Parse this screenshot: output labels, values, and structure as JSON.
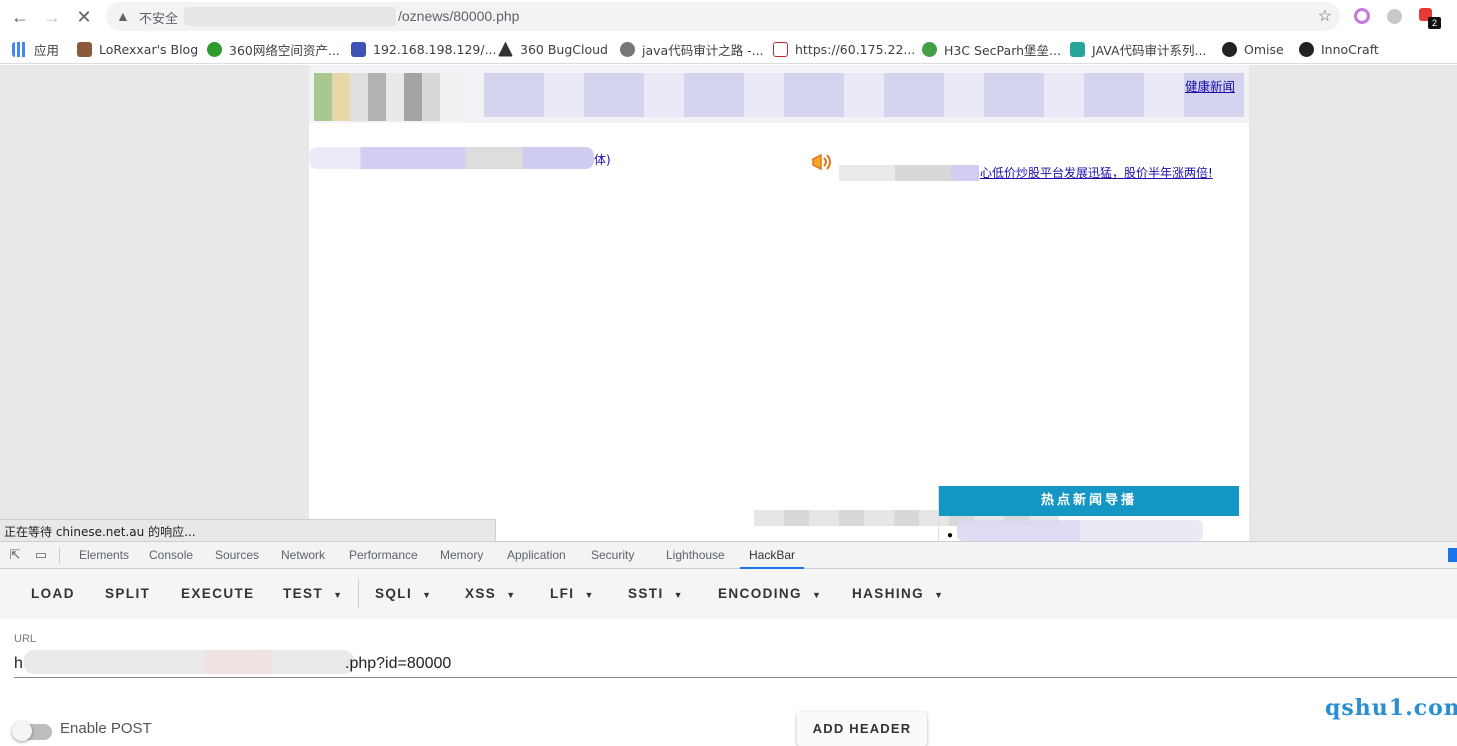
{
  "browser": {
    "insecure_label": "不安全",
    "url_tail": "/oznews/80000.php",
    "badge_count": "2"
  },
  "bookmarks": [
    {
      "label": "应用",
      "color": "#4285f4"
    },
    {
      "label": "LoRexxar's Blog",
      "color": "#8b5a3c"
    },
    {
      "label": "360网络空间资产...",
      "color": "#2e9b2e"
    },
    {
      "label": "192.168.198.129/...",
      "color": "#3f51b5"
    },
    {
      "label": "360 BugCloud",
      "color": "#333333"
    },
    {
      "label": "java代码审计之路 -...",
      "color": "#555555"
    },
    {
      "label": "https://60.175.22...",
      "color": "#c62828"
    },
    {
      "label": "H3C SecParh堡垒...",
      "color": "#43a047"
    },
    {
      "label": "JAVA代码审计系列...",
      "color": "#26a69a"
    },
    {
      "label": "Omise",
      "color": "#222222"
    },
    {
      "label": "InnoCraft",
      "color": "#222222"
    }
  ],
  "page": {
    "nav_last": "健康新闻",
    "site_title_tail": "体)",
    "ticker": "心低价炒股平台发展迅猛，股价半年涨两倍!",
    "hot_news_title": "热点新闻导播",
    "status_text": "正在等待 chinese.net.au 的响应..."
  },
  "devtools": {
    "tabs": [
      "Elements",
      "Console",
      "Sources",
      "Network",
      "Performance",
      "Memory",
      "Application",
      "Security",
      "Lighthouse",
      "HackBar"
    ],
    "active_tab": "HackBar"
  },
  "hackbar": {
    "buttons": [
      {
        "label": "LOAD",
        "dropdown": false
      },
      {
        "label": "SPLIT",
        "dropdown": false
      },
      {
        "label": "EXECUTE",
        "dropdown": false
      },
      {
        "label": "TEST",
        "dropdown": true
      },
      {
        "label": "SQLI",
        "dropdown": true
      },
      {
        "label": "XSS",
        "dropdown": true
      },
      {
        "label": "LFI",
        "dropdown": true
      },
      {
        "label": "SSTI",
        "dropdown": true
      },
      {
        "label": "ENCODING",
        "dropdown": true
      },
      {
        "label": "HASHING",
        "dropdown": true
      }
    ],
    "url_label": "URL",
    "url_start": "h",
    "url_end": ".php?id=80000",
    "enable_post": "Enable POST",
    "add_header": "ADD HEADER"
  },
  "watermark": "qshu1.com"
}
